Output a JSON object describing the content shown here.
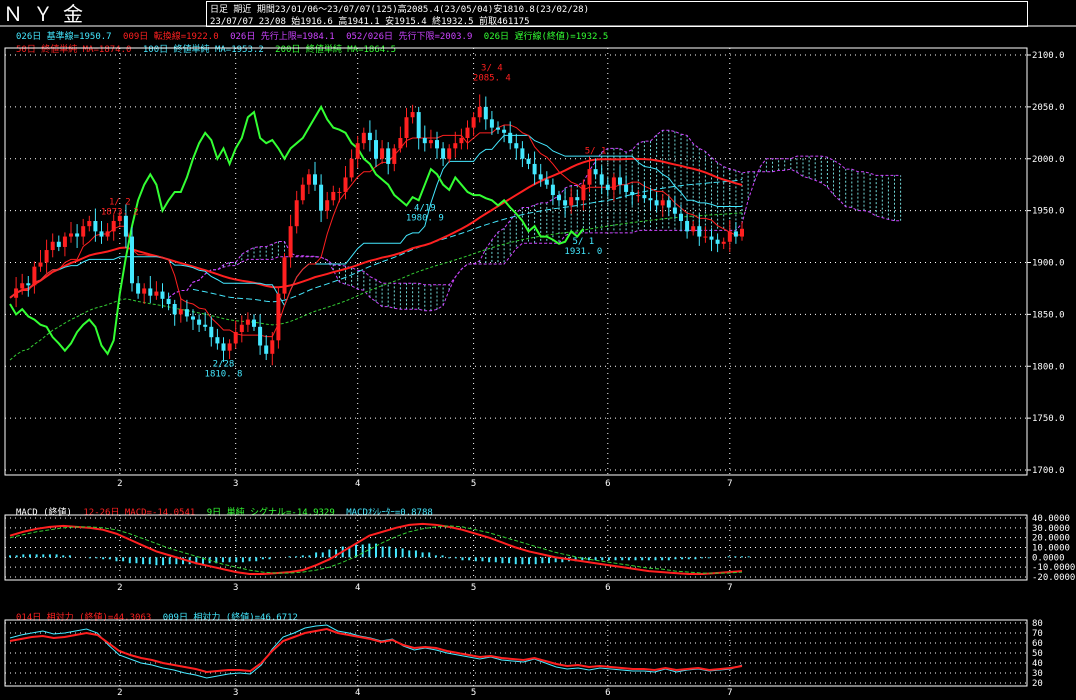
{
  "header": {
    "title": "ＮＹ金",
    "line1": "日足 期近  期間23/01/06～23/07/07(125)高2085.4(23/05/04)安1810.8(23/02/28)",
    "line2": "23/07/07 23/08 始1916.6 高1941.1 安1915.4 終1932.5 前取461175"
  },
  "colors": {
    "up": "#ff2020",
    "down": "#44e8ff",
    "kijun": "#44e8ff",
    "tenkan": "#ff2020",
    "chikou": "#33ff33",
    "ma50": "#ff2020",
    "ma100": "#44e8ff",
    "ma200": "#33cc33",
    "cloud": "#88ffff",
    "spanB": "#cc44ff",
    "macd": "#ff2020",
    "signal": "#33cc33",
    "hist": "#44e8ff",
    "rsi14": "#ff2020",
    "rsi9": "#44e8ff"
  },
  "legend_main": {
    "row1": [
      {
        "text": "026日 基準線=1950.7",
        "color": "#44e8ff"
      },
      {
        "text": "009日 転換線=1922.0",
        "color": "#ff2020"
      },
      {
        "text": "026日 先行上限=1984.1",
        "color": "#cc44ff"
      },
      {
        "text": "052/026日 先行下限=2003.9",
        "color": "#cc44ff"
      },
      {
        "text": "026日 遅行線(終値)=1932.5",
        "color": "#33ff33"
      }
    ],
    "row2": [
      {
        "text": "50日 終値単純 MA=1874.0",
        "color": "#ff2020"
      },
      {
        "text": "100日 終値単純 MA=1953.2",
        "color": "#44e8ff"
      },
      {
        "text": "200日 終値単純 MA=1864.5",
        "color": "#33ff33"
      }
    ]
  },
  "legend_macd": [
    {
      "text": "MACD (終値)",
      "color": "#ffffff"
    },
    {
      "text": "12-26日 MACD=-14.0541",
      "color": "#ff2020"
    },
    {
      "text": "9日 単純 シグナル=-14.9329",
      "color": "#33ff33"
    },
    {
      "text": "MACDｵｼﾚｰﾀｰ=0.8788",
      "color": "#44e8ff"
    }
  ],
  "legend_rsi": [
    {
      "text": "014日 相対力 (終値)=44.3063",
      "color": "#ff2020"
    },
    {
      "text": "009日 相対力 (終値)=46.6712",
      "color": "#44e8ff"
    }
  ],
  "chart_data": [
    {
      "type": "candlestick",
      "panel": "price",
      "ylim": [
        1700,
        2100
      ],
      "y_ticks": [
        "1700.0",
        "1750.0",
        "1800.0",
        "1850.0",
        "1900.0",
        "1950.0",
        "2000.0",
        "2050.0",
        "2100.0"
      ],
      "x_ticks": [
        "2",
        "3",
        "4",
        "5",
        "6",
        "7"
      ],
      "x_tick_index": [
        18,
        37,
        57,
        76,
        98,
        118
      ],
      "closes": [
        1866,
        1875,
        1880,
        1878,
        1896,
        1900,
        1912,
        1920,
        1915,
        1925,
        1928,
        1925,
        1935,
        1940,
        1930,
        1925,
        1930,
        1940,
        1945,
        1925,
        1880,
        1870,
        1875,
        1868,
        1872,
        1865,
        1860,
        1850,
        1855,
        1848,
        1845,
        1840,
        1838,
        1828,
        1822,
        1815,
        1822,
        1833,
        1840,
        1845,
        1838,
        1820,
        1812,
        1825,
        1870,
        1905,
        1935,
        1960,
        1975,
        1985,
        1975,
        1950,
        1960,
        1968,
        1968,
        1982,
        2000,
        2015,
        2025,
        2018,
        2000,
        2010,
        1995,
        2010,
        2020,
        2040,
        2045,
        2020,
        2015,
        2018,
        2010,
        2000,
        2010,
        2015,
        2020,
        2030,
        2040,
        2050,
        2038,
        2030,
        2028,
        2025,
        2015,
        2010,
        2000,
        1995,
        1985,
        1980,
        1975,
        1965,
        1960,
        1955,
        1963,
        1960,
        1975,
        1990,
        1985,
        1975,
        1970,
        1982,
        1975,
        1968,
        1965,
        1965,
        1962,
        1960,
        1955,
        1960,
        1953,
        1947,
        1940,
        1930,
        1935,
        1925,
        1925,
        1922,
        1918,
        1920,
        1930,
        1925,
        1932.5
      ],
      "labels": [
        {
          "text": "1/ 2",
          "sub": "1873. 2",
          "i": 18,
          "value": 1956,
          "color": "#ff2020"
        },
        {
          "text": "2/28",
          "sub": "1810. 8",
          "i": 35,
          "value": 1800,
          "color": "#44e8ff"
        },
        {
          "text": "3/ 4",
          "sub": "2085. 4",
          "i": 79,
          "value": 2085,
          "color": "#ff2020"
        },
        {
          "text": "4/19",
          "sub": "1980. 9",
          "i": 68,
          "value": 1950,
          "color": "#44e8ff"
        },
        {
          "text": "5/ 1",
          "sub": "1931. 0",
          "i": 94,
          "value": 1918,
          "color": "#44e8ff"
        },
        {
          "text": "5/ 1",
          "sub": "",
          "i": 96,
          "value": 2005,
          "color": "#ff2020"
        }
      ]
    },
    {
      "type": "line",
      "panel": "macd",
      "ylim": [
        -20,
        40
      ],
      "y_ticks": [
        "40.0000",
        "30.0000",
        "20.0000",
        "10.0000",
        "0.0000",
        "-10.0000",
        "-20.0000"
      ],
      "series": [
        {
          "name": "MACD",
          "color": "#ff2020",
          "values": [
            22,
            26,
            29,
            31,
            32,
            31,
            30,
            28,
            24,
            18,
            12,
            6,
            2,
            -2,
            -6,
            -9,
            -12,
            -15,
            -17,
            -17,
            -16,
            -15,
            -13,
            -8,
            -2,
            6,
            14,
            22,
            26,
            30,
            33,
            34,
            33,
            31,
            28,
            24,
            20,
            15,
            10,
            6,
            3,
            0,
            -2,
            -4,
            -6,
            -8,
            -10,
            -12,
            -14,
            -15,
            -16,
            -17,
            -17,
            -16,
            -15,
            -14
          ]
        },
        {
          "name": "シグナル",
          "color": "#33cc33",
          "values": [
            20,
            23,
            26,
            28,
            30,
            31,
            31,
            30,
            28,
            24,
            19,
            14,
            9,
            5,
            1,
            -3,
            -7,
            -10,
            -13,
            -15,
            -16,
            -16,
            -15,
            -13,
            -10,
            -5,
            1,
            8,
            15,
            21,
            26,
            29,
            31,
            32,
            31,
            28,
            25,
            21,
            17,
            13,
            9,
            5,
            2,
            -1,
            -3,
            -5,
            -7,
            -9,
            -11,
            -12,
            -14,
            -15,
            -16,
            -16,
            -16,
            -15
          ]
        }
      ],
      "histogram": [
        2,
        3,
        3,
        3,
        2,
        0,
        -1,
        -2,
        -4,
        -6,
        -7,
        -8,
        -7,
        -7,
        -7,
        -6,
        -5,
        -5,
        -4,
        -2,
        0,
        1,
        2,
        5,
        8,
        11,
        13,
        14,
        11,
        9,
        7,
        5,
        2,
        -1,
        -3,
        -4,
        -5,
        -6,
        -7,
        -7,
        -6,
        -5,
        -4,
        -3,
        -3,
        -3,
        -3,
        -3,
        -3,
        -3,
        -2,
        -2,
        -1,
        0,
        1,
        1
      ]
    },
    {
      "type": "line",
      "panel": "rsi",
      "ylim": [
        20,
        80
      ],
      "y_ticks": [
        "80",
        "70",
        "60",
        "50",
        "40",
        "30",
        "20"
      ],
      "series": [
        {
          "name": "14日",
          "color": "#ff2020",
          "values": [
            62,
            64,
            66,
            67,
            65,
            66,
            68,
            70,
            68,
            60,
            52,
            48,
            45,
            43,
            40,
            38,
            36,
            34,
            31,
            32,
            33,
            33,
            32,
            40,
            52,
            62,
            66,
            70,
            72,
            74,
            70,
            68,
            66,
            64,
            61,
            63,
            58,
            55,
            56,
            55,
            52,
            50,
            48,
            46,
            47,
            45,
            44,
            43,
            45,
            42,
            39,
            37,
            38,
            36,
            37,
            36,
            35,
            34,
            34,
            33,
            35,
            33,
            34,
            35,
            33,
            34,
            35,
            37
          ]
        },
        {
          "name": "9日",
          "color": "#44e8ff",
          "values": [
            65,
            68,
            70,
            72,
            69,
            70,
            72,
            74,
            70,
            58,
            48,
            44,
            40,
            38,
            35,
            33,
            30,
            28,
            25,
            27,
            29,
            30,
            29,
            38,
            54,
            66,
            70,
            75,
            77,
            78,
            72,
            70,
            67,
            65,
            62,
            64,
            57,
            53,
            55,
            53,
            50,
            48,
            46,
            44,
            46,
            43,
            42,
            41,
            44,
            40,
            36,
            34,
            35,
            33,
            35,
            34,
            33,
            32,
            32,
            31,
            34,
            31,
            33,
            34,
            32,
            33,
            34,
            38
          ]
        }
      ]
    }
  ]
}
